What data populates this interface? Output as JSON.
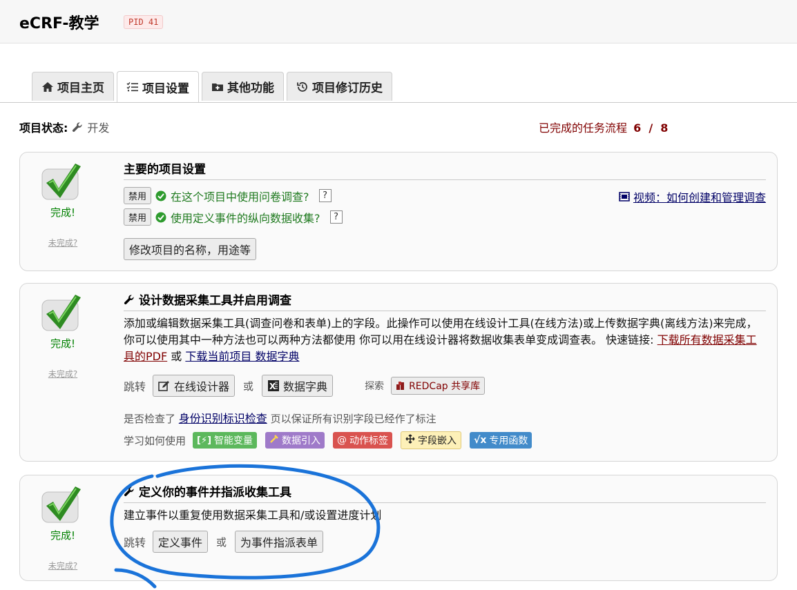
{
  "header": {
    "title": "eCRF-教学",
    "pid": "PID 41"
  },
  "tabs": [
    {
      "label": "项目主页",
      "icon": "home-icon"
    },
    {
      "label": "项目设置",
      "icon": "list-check-icon",
      "active": true
    },
    {
      "label": "其他功能",
      "icon": "folder-plus-icon"
    },
    {
      "label": "项目修订历史",
      "icon": "history-icon"
    }
  ],
  "status": {
    "label": "项目状态:",
    "value": "开发"
  },
  "progress": {
    "prefix": "已完成的任务流程",
    "done": "6",
    "sep": "/",
    "total": "8"
  },
  "common": {
    "done": "完成!",
    "undone": "未完成?",
    "goto": "跳转",
    "or": "或"
  },
  "card1": {
    "title": "主要的项目设置",
    "btn_disable": "禁用",
    "option1": "在这个项目中使用问卷调查?",
    "option2": "使用定义事件的纵向数据收集?",
    "help": "?",
    "video_link": "视频：如何创建和管理调查",
    "modify_button": "修改项目的名称，用途等"
  },
  "card2": {
    "title": "设计数据采集工具并启用调查",
    "desc": "添加或编辑数据采集工具(调查问卷和表单)上的字段。此操作可以使用在线设计工具(在线方法)或上传数据字典(离线方法)来完成，你可以使用其中一种方法也可以两种方法都使用 你可以用在线设计器将数据收集表单变成调查表。 快速链接: ",
    "link_pdf": "下载所有数据采集工具的PDF",
    "or_text": " 或 ",
    "link_dict": "下载当前项目 数据字典",
    "btn_designer": "在线设计器",
    "btn_dict": "数据字典",
    "explore": "探索",
    "btn_library": "REDCap 共享库",
    "check_prefix": "是否检查了",
    "check_link": "身份识别标识检查",
    "check_suffix": "页以保证所有识别字段已经作了标注",
    "learn": "学习如何使用",
    "tags": [
      {
        "label": "智能变量",
        "color": "#5cb85c",
        "icon": "smart-variable-icon"
      },
      {
        "label": "数据引入",
        "color": "#9f7ac9",
        "icon": "piping-icon"
      },
      {
        "label": "动作标签",
        "color": "#d9534f",
        "icon": "action-tag-icon"
      },
      {
        "label": "字段嵌入",
        "color": "#fdf0b8",
        "icon": "field-embed-icon"
      },
      {
        "label": "专用函数",
        "color": "#428bca",
        "icon": "function-icon"
      }
    ]
  },
  "card3": {
    "title": "定义你的事件并指派收集工具",
    "desc": "建立事件以重复使用数据采集工具和/或设置进度计划",
    "btn_events": "定义事件",
    "btn_assign": "为事件指派表单"
  },
  "colors": {
    "accent_red": "#800000",
    "done_green": "#008000",
    "link_blue": "#000066",
    "annotation_blue": "#1a73d9"
  }
}
